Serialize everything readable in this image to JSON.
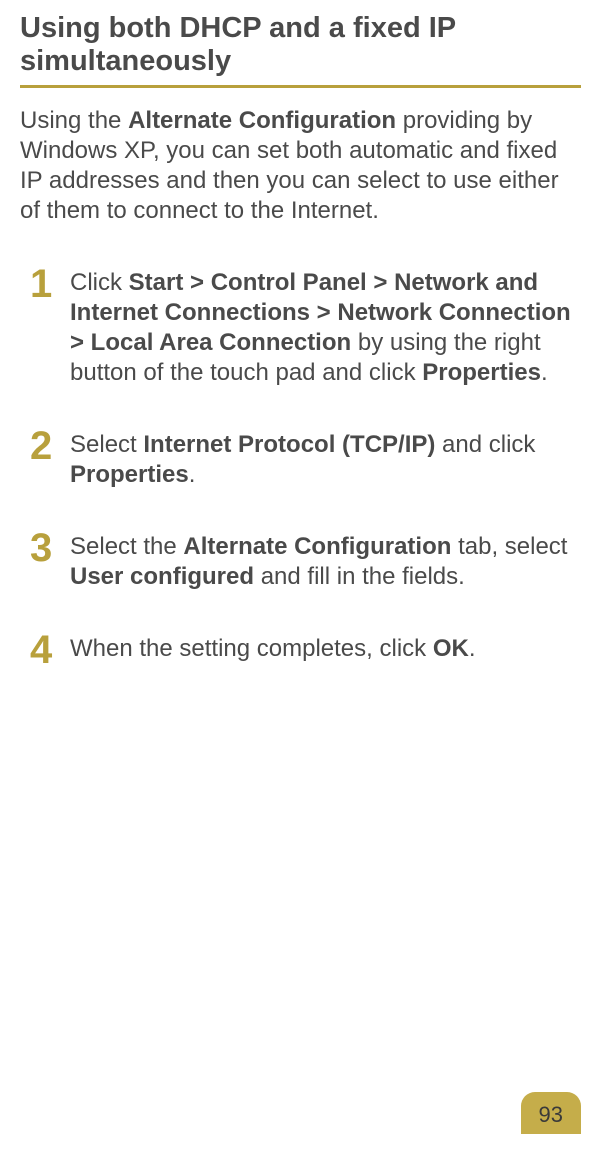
{
  "heading": "Using both DHCP and a fixed IP simultaneously",
  "intro": {
    "prefix": "Using the ",
    "bold1": "Alternate Configuration",
    "suffix": " providing by Windows XP, you can set both automatic and fixed IP addresses and then you can select to use either of them to connect to the Internet."
  },
  "steps": [
    {
      "number": "1",
      "parts": [
        {
          "text": "Click ",
          "bold": false
        },
        {
          "text": "Start > Control Panel > Network and Internet Connections > Network Connection > Local Area Connection",
          "bold": true
        },
        {
          "text": " by using the right button of the touch pad and click ",
          "bold": false
        },
        {
          "text": "Properties",
          "bold": true
        },
        {
          "text": ".",
          "bold": false
        }
      ]
    },
    {
      "number": "2",
      "parts": [
        {
          "text": "Select ",
          "bold": false
        },
        {
          "text": "Internet Protocol (TCP/IP)",
          "bold": true
        },
        {
          "text": " and click ",
          "bold": false
        },
        {
          "text": "Properties",
          "bold": true
        },
        {
          "text": ".",
          "bold": false
        }
      ]
    },
    {
      "number": "3",
      "parts": [
        {
          "text": "Select the ",
          "bold": false
        },
        {
          "text": "Alternate Configuration",
          "bold": true
        },
        {
          "text": " tab, select ",
          "bold": false
        },
        {
          "text": "User configured",
          "bold": true
        },
        {
          "text": " and fill in the fields.",
          "bold": false
        }
      ]
    },
    {
      "number": "4",
      "parts": [
        {
          "text": "When the setting completes, click ",
          "bold": false
        },
        {
          "text": "OK",
          "bold": true
        },
        {
          "text": ".",
          "bold": false
        }
      ]
    }
  ],
  "pageNumber": "93"
}
